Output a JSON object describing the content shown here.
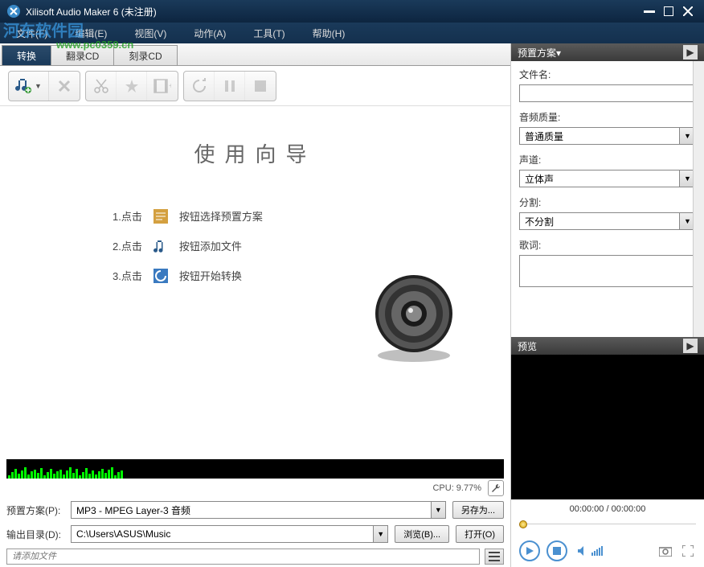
{
  "title": "Xilisoft Audio Maker 6 (未注册)",
  "watermark_text": "河东软件园",
  "watermark_url": "www.pc0359.cn",
  "menu": {
    "file": "文件(F)",
    "edit": "编辑(E)",
    "view": "视图(V)",
    "action": "动作(A)",
    "tools": "工具(T)",
    "help": "帮助(H)"
  },
  "tabs": {
    "convert": "转换",
    "rip": "翻录CD",
    "burn": "刻录CD"
  },
  "wizard": {
    "title": "使用向导",
    "step1_prefix": "1.点击",
    "step1_text": "按钮选择预置方案",
    "step2_prefix": "2.点击",
    "step2_text": "按钮添加文件",
    "step3_prefix": "3.点击",
    "step3_text": "按钮开始转换"
  },
  "cpu": {
    "label": "CPU: 9.77%"
  },
  "profile": {
    "label": "预置方案(P):",
    "value": "MP3 - MPEG Layer-3 音频",
    "saveas": "另存为..."
  },
  "output": {
    "label": "输出目录(D):",
    "value": "C:\\Users\\ASUS\\Music",
    "browse": "浏览(B)...",
    "open": "打开(O)"
  },
  "search_placeholder": "请添加文件",
  "right_panel": {
    "preset_header": "预置方案",
    "filename_label": "文件名:",
    "filename_value": "",
    "quality_label": "音频质量:",
    "quality_value": "普通质量",
    "channel_label": "声道:",
    "channel_value": "立体声",
    "split_label": "分割:",
    "split_value": "不分割",
    "lyrics_label": "歌词:",
    "lyrics_value": "",
    "preview_header": "预览",
    "time": "00:00:00 / 00:00:00"
  }
}
